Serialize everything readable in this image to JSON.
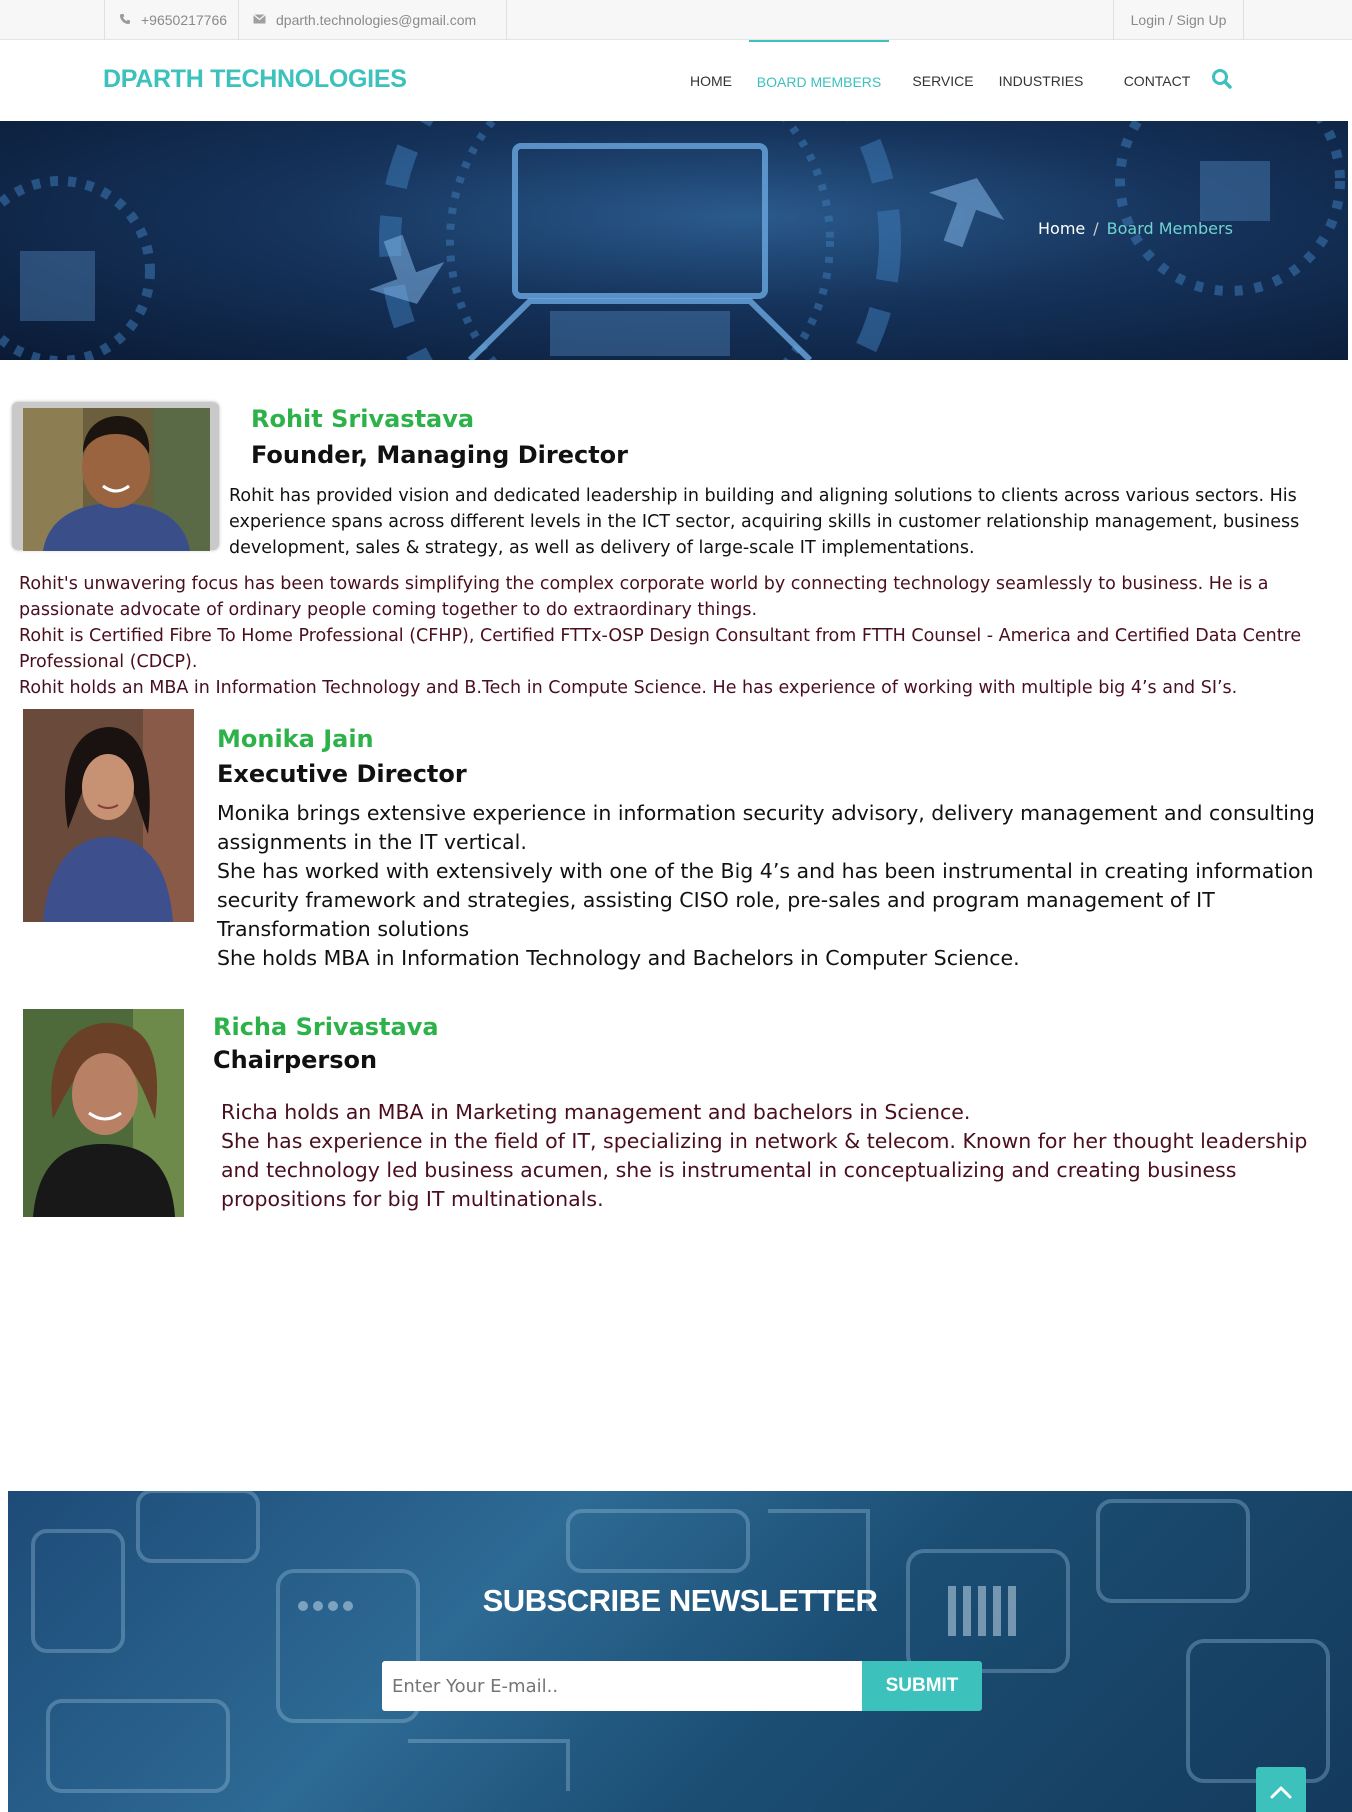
{
  "topbar": {
    "phone": "+9650217766",
    "email": "dparth.technologies@gmail.com",
    "login": "Login / Sign Up"
  },
  "header": {
    "logo": "DPARTH TECHNOLOGIES",
    "nav": [
      "HOME",
      "BOARD MEMBERS",
      "SERVICE",
      "INDUSTRIES",
      "CONTACT"
    ],
    "active": "BOARD MEMBERS"
  },
  "breadcrumb": {
    "home": "Home",
    "sep": "/",
    "current": "Board Members"
  },
  "members": [
    {
      "name": "Rohit Srivastava",
      "role": "Founder, Managing Director",
      "bio": [
        "Rohit has provided vision and dedicated leadership in building and aligning solutions to clients across various sectors. His experience spans across different levels in the ICT sector, acquiring skills in customer relationship management, business development, sales & strategy, as well as delivery of large-scale IT implementations.",
        "Rohit's unwavering focus has been towards simplifying the complex corporate world by connecting technology seamlessly to business. He is a passionate advocate of ordinary people coming together to do extraordinary things.",
        "Rohit is Certified Fibre To Home Professional (CFHP), Certified FTTx-OSP Design Consultant from FTTH Counsel - America and Certified Data Centre Professional (CDCP).",
        "Rohit holds an MBA in Information Technology and B.Tech in Compute Science. He has experience of working with multiple big 4’s and SI’s."
      ]
    },
    {
      "name": "Monika Jain",
      "role": "Executive Director",
      "bio": [
        "Monika brings extensive experience in information security advisory, delivery management and consulting assignments in the IT vertical.",
        "She has worked with extensively with one of the Big 4’s and has been instrumental in creating information security framework and strategies, assisting CISO role, pre-sales and program management of IT Transformation solutions",
        "She holds MBA in Information Technology and Bachelors in Computer Science."
      ]
    },
    {
      "name": "Richa Srivastava",
      "role": "Chairperson",
      "bio": [
        "Richa holds an MBA in Marketing management and bachelors in Science.",
        "She has experience in the field of IT, specializing in network & telecom. Known for her thought leadership and technology led business acumen, she is instrumental in conceptualizing and creating business propositions for big IT multinationals."
      ]
    }
  ],
  "newsletter": {
    "title": "SUBSCRIBE NEWSLETTER",
    "placeholder": "Enter Your E-mail..",
    "submit": "SUBMIT"
  },
  "colors": {
    "accent": "#3cc1bd",
    "name_green": "#2db24a",
    "maroon": "#4a0f1e"
  },
  "icons": [
    "phone-icon",
    "envelope-icon",
    "search-icon",
    "chevron-up-icon"
  ]
}
